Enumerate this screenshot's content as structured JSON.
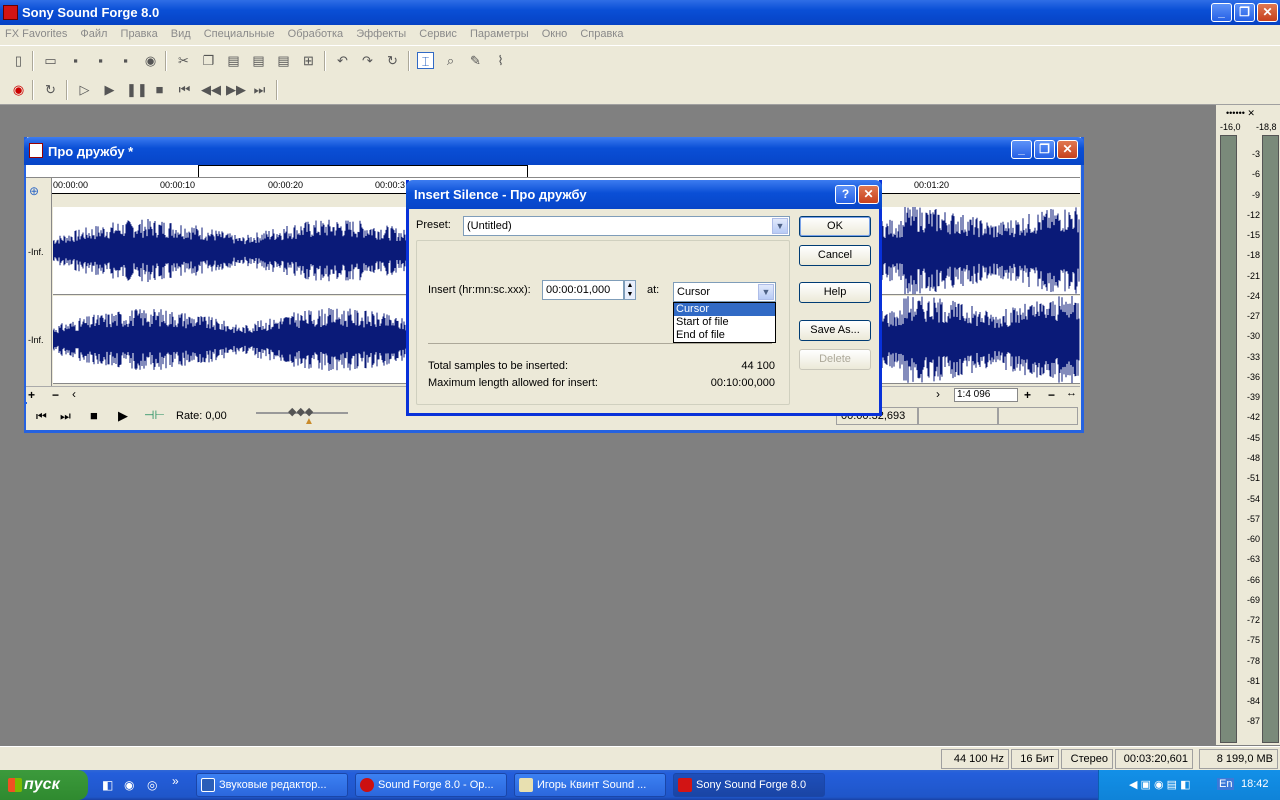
{
  "app": {
    "title": "Sony Sound Forge 8.0",
    "window_buttons": {
      "minimize": "_",
      "maximize": "❐",
      "close": "✕"
    }
  },
  "menu": [
    "FX Favorites",
    "Файл",
    "Правка",
    "Вид",
    "Специальные",
    "Обработка",
    "Эффекты",
    "Сервис",
    "Параметры",
    "Окно",
    "Справка"
  ],
  "data_window": {
    "title": "Про дружбу *",
    "ruler_labels": [
      "00:00:00",
      "00:00:10",
      "00:00:20",
      "00:00:3",
      "00:01:20"
    ],
    "channel_labels": [
      "-Inf.",
      "-Inf."
    ],
    "zoom_ratio": "1:4 096",
    "rate_label": "Rate: 0,00",
    "position": "00:00:32,693"
  },
  "dialog": {
    "title": "Insert Silence - Про дружбу",
    "help_icon": "?",
    "preset_label": "Preset:",
    "preset_value": "(Untitled)",
    "insert_label": "Insert (hr:mn:sc.xxx):",
    "insert_value": "00:00:01,000",
    "at_label": "at:",
    "at_value": "Cursor",
    "at_options": [
      "Cursor",
      "Start of file",
      "End of file"
    ],
    "total_samples_label": "Total samples to be inserted:",
    "total_samples_value": "44 100",
    "max_length_label": "Maximum length allowed for insert:",
    "max_length_value": "00:10:00,000",
    "buttons": {
      "ok": "OK",
      "cancel": "Cancel",
      "help": "Help",
      "save_as": "Save As...",
      "delete": "Delete"
    }
  },
  "meter": {
    "header": "••••••  ✕",
    "left_peak": "-16,0",
    "right_peak": "-18,8",
    "scale": [
      "3",
      "6",
      "9",
      "12",
      "15",
      "18",
      "21",
      "24",
      "27",
      "30",
      "33",
      "36",
      "39",
      "42",
      "45",
      "48",
      "51",
      "54",
      "57",
      "60",
      "63",
      "66",
      "69",
      "72",
      "75",
      "78",
      "81",
      "84",
      "87"
    ]
  },
  "status_bar": {
    "sample_rate": "44 100 Hz",
    "bit_depth": "16 Бит",
    "channels": "Стерео",
    "length": "00:03:20,601",
    "free_space": "8 199,0 MB"
  },
  "taskbar": {
    "start_label": "пуск",
    "tasks": [
      "Звуковые редактор...",
      "Sound Forge 8.0 - Op...",
      "Игорь Квинт Sound ...",
      "Sony Sound Forge 8.0"
    ],
    "language": "EN",
    "tray_language": "En",
    "clock": "18:42"
  }
}
